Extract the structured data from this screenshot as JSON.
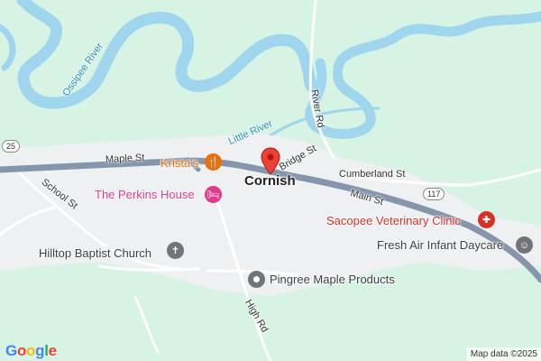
{
  "place": {
    "name": "Cornish"
  },
  "roads": {
    "maple_st": "Maple St",
    "bridge_st": "Bridge St",
    "cumberland_st": "Cumberland St",
    "main_st": "Main St",
    "school_st": "School St",
    "river_rd": "River Rd",
    "high_rd": "High Rd"
  },
  "route_shields": {
    "west": "25",
    "east": "117"
  },
  "water": {
    "ossipee_river": "Ossipee River",
    "little_river": "Little River"
  },
  "pois": {
    "kristas": {
      "name": "Krista's",
      "icon": "restaurant-icon",
      "color": "#e8710a"
    },
    "perkins_house": {
      "name": "The Perkins House",
      "icon": "hotel-icon",
      "color": "#e4388c"
    },
    "sacopee_vet": {
      "name": "Sacopee Veterinary Clinic",
      "icon": "veterinary-icon",
      "color": "#d93025"
    },
    "fresh_air": {
      "name": "Fresh Air Infant Daycare",
      "icon": "daycare-icon",
      "color": "#70757a"
    },
    "hilltop_baptist": {
      "name": "Hilltop Baptist Church",
      "icon": "church-icon",
      "color": "#70757a"
    },
    "pingree_maple": {
      "name": "Pingree Maple Products",
      "icon": "place-icon",
      "color": "#70757a"
    }
  },
  "logo": "Google",
  "attribution": "Map data ©2025",
  "colors": {
    "land": "#d7f3e3",
    "water": "#9fd6ee",
    "urban": "#eef0f2",
    "highway": "#8595ac",
    "marker": "#ea4335"
  }
}
